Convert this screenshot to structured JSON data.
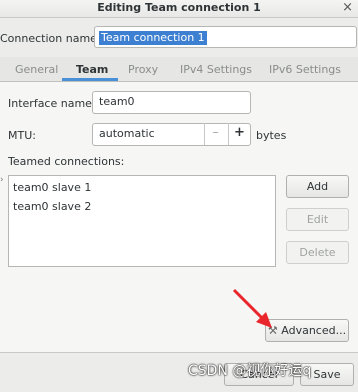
{
  "window": {
    "title": "Editing Team connection 1",
    "close_glyph": "×"
  },
  "connection": {
    "label": "Connection name:",
    "value": "Team connection 1"
  },
  "tabs": [
    {
      "label": "General"
    },
    {
      "label": "Team"
    },
    {
      "label": "Proxy"
    },
    {
      "label": "IPv4 Settings"
    },
    {
      "label": "IPv6 Settings"
    }
  ],
  "team": {
    "interface_label": "Interface name:",
    "interface_value": "team0",
    "mtu_label": "MTU:",
    "mtu_value": "automatic",
    "mtu_minus": "–",
    "mtu_plus": "+",
    "mtu_unit": "bytes",
    "teamed_label": "Teamed connections:",
    "teamed": [
      "team0 slave 1",
      "team0 slave 2"
    ],
    "add_label": "Add",
    "edit_label": "Edit",
    "delete_label": "Delete",
    "advanced_label": "Advanced..."
  },
  "footer": {
    "cancel_label": "Cancel",
    "save_label": "Save"
  },
  "watermark": "CSDN @视你好运q",
  "colors": {
    "accent": "#4a90d9",
    "selection": "#3d7fd1",
    "arrow": "#e8262b"
  }
}
